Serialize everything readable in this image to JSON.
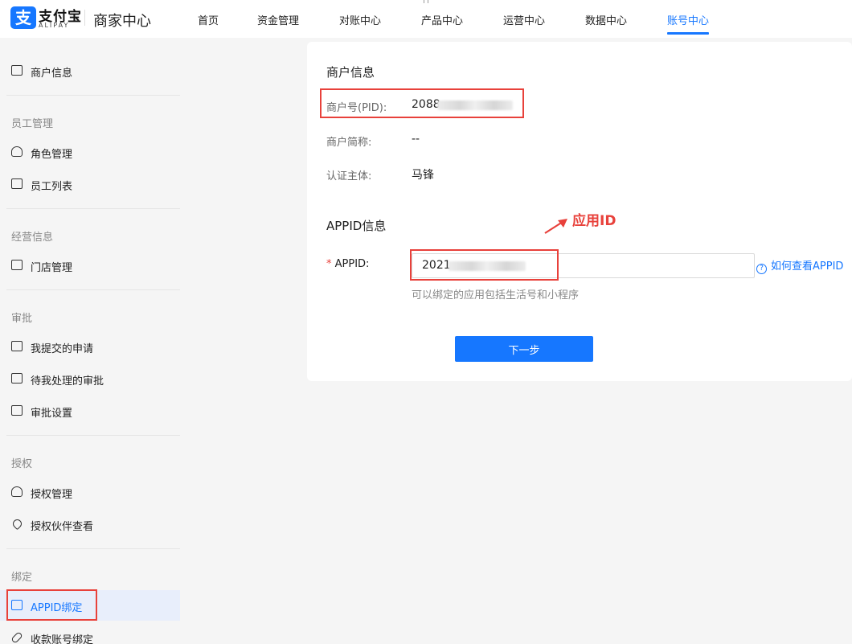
{
  "brand": {
    "logo_glyph": "支",
    "name_cn": "支付宝",
    "name_en": "ALIPAY",
    "site_title": "商家中心"
  },
  "nav": {
    "items": [
      "首页",
      "资金管理",
      "对账中心",
      "产品中心",
      "运营中心",
      "数据中心",
      "账号中心"
    ],
    "active_index": 6
  },
  "sidebar": {
    "top_item": "商户信息",
    "groups": [
      {
        "label": "员工管理",
        "items": [
          "角色管理",
          "员工列表"
        ]
      },
      {
        "label": "经营信息",
        "items": [
          "门店管理"
        ]
      },
      {
        "label": "审批",
        "items": [
          "我提交的申请",
          "待我处理的审批",
          "审批设置"
        ]
      },
      {
        "label": "授权",
        "items": [
          "授权管理",
          "授权伙伴查看"
        ]
      },
      {
        "label": "绑定",
        "items": [
          "APPID绑定",
          "收款账号绑定"
        ]
      }
    ],
    "active_item": "APPID绑定"
  },
  "merchant_info": {
    "title": "商户信息",
    "pid_label": "商户号(PID):",
    "pid_value": "2088",
    "short_name_label": "商户简称:",
    "short_name_value": "--",
    "entity_label": "认证主体:",
    "entity_value": "马锋"
  },
  "appid_info": {
    "title": "APPID信息",
    "required_mark": "*",
    "appid_label": "APPID:",
    "appid_value": "2021",
    "help_link": "如何查看APPID",
    "hint": "可以绑定的应用包括生活号和小程序",
    "next_button": "下一步"
  },
  "annotation": {
    "text": "应用ID",
    "color": "#e8413b"
  },
  "colors": {
    "accent": "#1677ff",
    "highlight": "#e8413b"
  }
}
